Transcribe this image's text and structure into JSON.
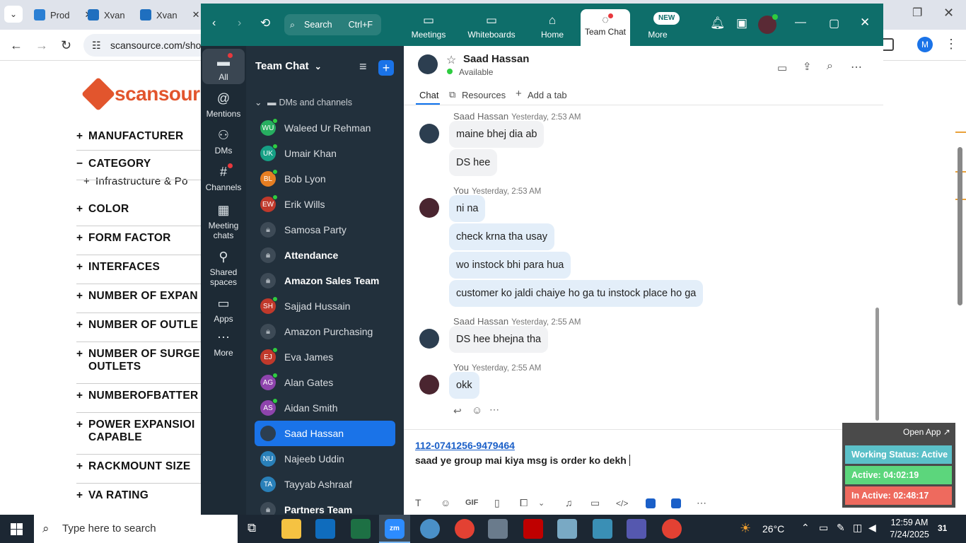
{
  "browser": {
    "tabs": [
      {
        "label": "Prod",
        "color": "#2a7fd4"
      },
      {
        "label": "Xvan",
        "color": "#1f6fbf"
      },
      {
        "label": "Xvan",
        "color": "#1f6fbf"
      }
    ],
    "url": "scansource.com/sho",
    "profile_initial": "M"
  },
  "page": {
    "logo_text": "scansour",
    "categories": [
      {
        "prefix": "+",
        "label": "MANUFACTURER"
      },
      {
        "prefix": "−",
        "label": "CATEGORY"
      },
      {
        "prefix": "+",
        "label": "Infrastructure & Po"
      },
      {
        "prefix": "+",
        "label": "COLOR"
      },
      {
        "prefix": "+",
        "label": "FORM FACTOR"
      },
      {
        "prefix": "+",
        "label": "INTERFACES"
      },
      {
        "prefix": "+",
        "label": "NUMBER OF EXPAN"
      },
      {
        "prefix": "+",
        "label": "NUMBER OF OUTLE"
      },
      {
        "prefix": "+",
        "label": "NUMBER OF SURGE"
      },
      {
        "prefix": "",
        "label": "OUTLETS"
      },
      {
        "prefix": "+",
        "label": "NUMBEROFBATTER"
      },
      {
        "prefix": "+",
        "label": "POWER EXPANSIOI"
      },
      {
        "prefix": "",
        "label": "CAPABLE"
      },
      {
        "prefix": "+",
        "label": "RACKMOUNT SIZE"
      },
      {
        "prefix": "+",
        "label": "VA RATING"
      }
    ]
  },
  "zoom": {
    "search_label": "Search",
    "search_shortcut": "Ctrl+F",
    "top_nav": [
      {
        "label": "Meetings",
        "icon": "video-camera-icon"
      },
      {
        "label": "Whiteboards",
        "icon": "whiteboard-icon"
      },
      {
        "label": "Home",
        "icon": "home-icon"
      },
      {
        "label": "Team Chat",
        "icon": "chat-icon"
      },
      {
        "label": "More",
        "icon": "more-icon"
      }
    ],
    "new_badge": "NEW",
    "left_nav": [
      {
        "label": "All",
        "icon": "chat-bubble-icon"
      },
      {
        "label": "Mentions",
        "icon": "at-icon"
      },
      {
        "label": "DMs",
        "icon": "people-icon"
      },
      {
        "label": "Channels",
        "icon": "hash-icon"
      },
      {
        "label": "Meeting chats",
        "icon": "calendar-icon"
      },
      {
        "label": "Shared spaces",
        "icon": "share-icon"
      },
      {
        "label": "Apps",
        "icon": "apps-icon"
      },
      {
        "label": "More",
        "icon": "more-icon"
      }
    ],
    "panel_title": "Team Chat",
    "section_label": "DMs and channels",
    "contacts": [
      {
        "initials": "WU",
        "name": "Waleed Ur Rehman",
        "color": "#27ae60",
        "online": true,
        "bold": false
      },
      {
        "initials": "UK",
        "name": "Umair Khan",
        "color": "#16a085",
        "online": true,
        "bold": false
      },
      {
        "initials": "BL",
        "name": "Bob Lyon",
        "color": "#e67e22",
        "online": true,
        "bold": false
      },
      {
        "initials": "EW",
        "name": "Erik Wills",
        "color": "#c0392b",
        "online": true,
        "bold": false
      },
      {
        "initials": "",
        "name": "Samosa Party",
        "color": "#3d4a56",
        "online": false,
        "bold": false,
        "locked": true
      },
      {
        "initials": "",
        "name": "Attendance",
        "color": "#3d4a56",
        "online": false,
        "bold": true,
        "locked": true
      },
      {
        "initials": "",
        "name": "Amazon Sales Team",
        "color": "#3d4a56",
        "online": false,
        "bold": true,
        "locked": true
      },
      {
        "initials": "SH",
        "name": "Sajjad Hussain",
        "color": "#c0392b",
        "online": true,
        "bold": false
      },
      {
        "initials": "",
        "name": "Amazon Purchasing",
        "color": "#3d4a56",
        "online": false,
        "bold": false,
        "locked": true
      },
      {
        "initials": "EJ",
        "name": "Eva James",
        "color": "#c0392b",
        "online": true,
        "bold": false
      },
      {
        "initials": "AG",
        "name": "Alan Gates",
        "color": "#8e44ad",
        "online": true,
        "bold": false
      },
      {
        "initials": "AS",
        "name": "Aidan Smith",
        "color": "#8e44ad",
        "online": true,
        "bold": false
      },
      {
        "initials": "",
        "name": "Saad Hassan",
        "color": "#2c3e50",
        "online": false,
        "bold": false,
        "selected": true
      },
      {
        "initials": "NU",
        "name": "Najeeb Uddin",
        "color": "#2980b9",
        "online": false,
        "bold": false
      },
      {
        "initials": "TA",
        "name": "Tayyab Ashraaf",
        "color": "#2980b9",
        "online": false,
        "bold": false
      },
      {
        "initials": "",
        "name": "Partners Team",
        "color": "#3d4a56",
        "online": false,
        "bold": true,
        "locked": true
      }
    ],
    "chat": {
      "contact_name": "Saad Hassan",
      "status": "Available",
      "tabs": [
        "Chat",
        "Resources",
        "Add a tab"
      ],
      "messages": [
        {
          "sender": "Saad Hassan",
          "time": "Yesterday, 2:53 AM",
          "me": false,
          "lines": [
            "maine bhej dia ab",
            "DS hee"
          ]
        },
        {
          "sender": "You",
          "time": "Yesterday, 2:53 AM",
          "me": true,
          "lines": [
            "ni na",
            "check krna tha usay",
            "wo instock bhi para hua",
            "customer ko jaldi chaiye ho ga tu instock place ho ga"
          ]
        },
        {
          "sender": "Saad Hassan",
          "time": "Yesterday, 2:55 AM",
          "me": false,
          "lines": [
            "DS hee bhejna tha"
          ]
        },
        {
          "sender": "You",
          "time": "Yesterday, 2:55 AM",
          "me": true,
          "lines": [
            "okk"
          ]
        }
      ],
      "compose_link": "112-0741256-9479464",
      "compose_text": "saad ye group mai kiya msg is order ko dekh"
    }
  },
  "widget": {
    "open_app": "Open App ↗",
    "status": "Working Status: Active",
    "active": "Active: 04:02:19",
    "inactive": "In Active: 02:48:17",
    "colors": {
      "status": "#5bc0c8",
      "active": "#5cd67c",
      "inactive": "#ee6a5e"
    }
  },
  "taskbar": {
    "search_placeholder": "Type here to search",
    "weather": "26°C",
    "time": "12:59 AM",
    "date": "7/24/2025",
    "notification_count": "31"
  }
}
